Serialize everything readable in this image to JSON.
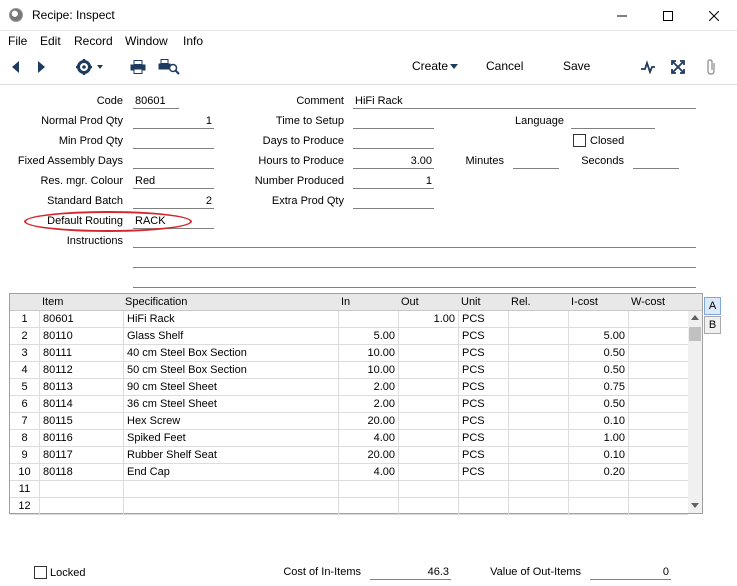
{
  "window": {
    "title": "Recipe: Inspect"
  },
  "menu": [
    "File",
    "Edit",
    "Record",
    "Window",
    "Info"
  ],
  "toolbar": {
    "create": "Create",
    "cancel": "Cancel",
    "save": "Save"
  },
  "form": {
    "code_label": "Code",
    "code": "80601",
    "normal_prod_qty_label": "Normal Prod Qty",
    "normal_prod_qty": "1",
    "min_prod_qty_label": "Min Prod Qty",
    "min_prod_qty": "",
    "fixed_assembly_days_label": "Fixed Assembly Days",
    "fixed_assembly_days": "",
    "res_mgr_colour_label": "Res. mgr. Colour",
    "res_mgr_colour": "Red",
    "standard_batch_label": "Standard Batch",
    "standard_batch": "2",
    "default_routing_label": "Default Routing",
    "default_routing": "RACK",
    "instructions_label": "Instructions",
    "comment_label": "Comment",
    "comment": "HiFi Rack",
    "time_to_setup_label": "Time to Setup",
    "time_to_setup": "",
    "days_to_produce_label": "Days to Produce",
    "days_to_produce": "",
    "hours_to_produce_label": "Hours to Produce",
    "hours_to_produce": "3.00",
    "number_produced_label": "Number Produced",
    "number_produced": "1",
    "extra_prod_qty_label": "Extra Prod Qty",
    "extra_prod_qty": "",
    "language_label": "Language",
    "language": "",
    "closed_label": "Closed",
    "minutes_label": "Minutes",
    "minutes": "",
    "seconds_label": "Seconds",
    "seconds": ""
  },
  "grid": {
    "headers": [
      "Item",
      "Specification",
      "In",
      "Out",
      "Unit",
      "Rel.",
      "I-cost",
      "W-cost"
    ],
    "rows": [
      {
        "n": "1",
        "item": "80601",
        "spec": "HiFi Rack",
        "in": "",
        "out": "1.00",
        "unit": "PCS",
        "rel": "",
        "icost": "",
        "wcost": ""
      },
      {
        "n": "2",
        "item": "80110",
        "spec": "Glass Shelf",
        "in": "5.00",
        "out": "",
        "unit": "PCS",
        "rel": "",
        "icost": "5.00",
        "wcost": ""
      },
      {
        "n": "3",
        "item": "80111",
        "spec": "40 cm Steel Box Section",
        "in": "10.00",
        "out": "",
        "unit": "PCS",
        "rel": "",
        "icost": "0.50",
        "wcost": ""
      },
      {
        "n": "4",
        "item": "80112",
        "spec": "50 cm Steel Box Section",
        "in": "10.00",
        "out": "",
        "unit": "PCS",
        "rel": "",
        "icost": "0.50",
        "wcost": ""
      },
      {
        "n": "5",
        "item": "80113",
        "spec": "90 cm Steel Sheet",
        "in": "2.00",
        "out": "",
        "unit": "PCS",
        "rel": "",
        "icost": "0.75",
        "wcost": ""
      },
      {
        "n": "6",
        "item": "80114",
        "spec": "36 cm Steel Sheet",
        "in": "2.00",
        "out": "",
        "unit": "PCS",
        "rel": "",
        "icost": "0.50",
        "wcost": ""
      },
      {
        "n": "7",
        "item": "80115",
        "spec": "Hex Screw",
        "in": "20.00",
        "out": "",
        "unit": "PCS",
        "rel": "",
        "icost": "0.10",
        "wcost": ""
      },
      {
        "n": "8",
        "item": "80116",
        "spec": "Spiked Feet",
        "in": "4.00",
        "out": "",
        "unit": "PCS",
        "rel": "",
        "icost": "1.00",
        "wcost": ""
      },
      {
        "n": "9",
        "item": "80117",
        "spec": "Rubber Shelf Seat",
        "in": "20.00",
        "out": "",
        "unit": "PCS",
        "rel": "",
        "icost": "0.10",
        "wcost": ""
      },
      {
        "n": "10",
        "item": "80118",
        "spec": "End Cap",
        "in": "4.00",
        "out": "",
        "unit": "PCS",
        "rel": "",
        "icost": "0.20",
        "wcost": ""
      },
      {
        "n": "11",
        "item": "",
        "spec": "",
        "in": "",
        "out": "",
        "unit": "",
        "rel": "",
        "icost": "",
        "wcost": ""
      },
      {
        "n": "12",
        "item": "",
        "spec": "",
        "in": "",
        "out": "",
        "unit": "",
        "rel": "",
        "icost": "",
        "wcost": ""
      }
    ],
    "tabs": [
      "A",
      "B"
    ]
  },
  "footer": {
    "locked_label": "Locked",
    "cost_in_label": "Cost of In-Items",
    "cost_in": "46.3",
    "value_out_label": "Value of Out-Items",
    "value_out": "0"
  },
  "colors": {
    "highlight_oval": "#d4262c"
  }
}
